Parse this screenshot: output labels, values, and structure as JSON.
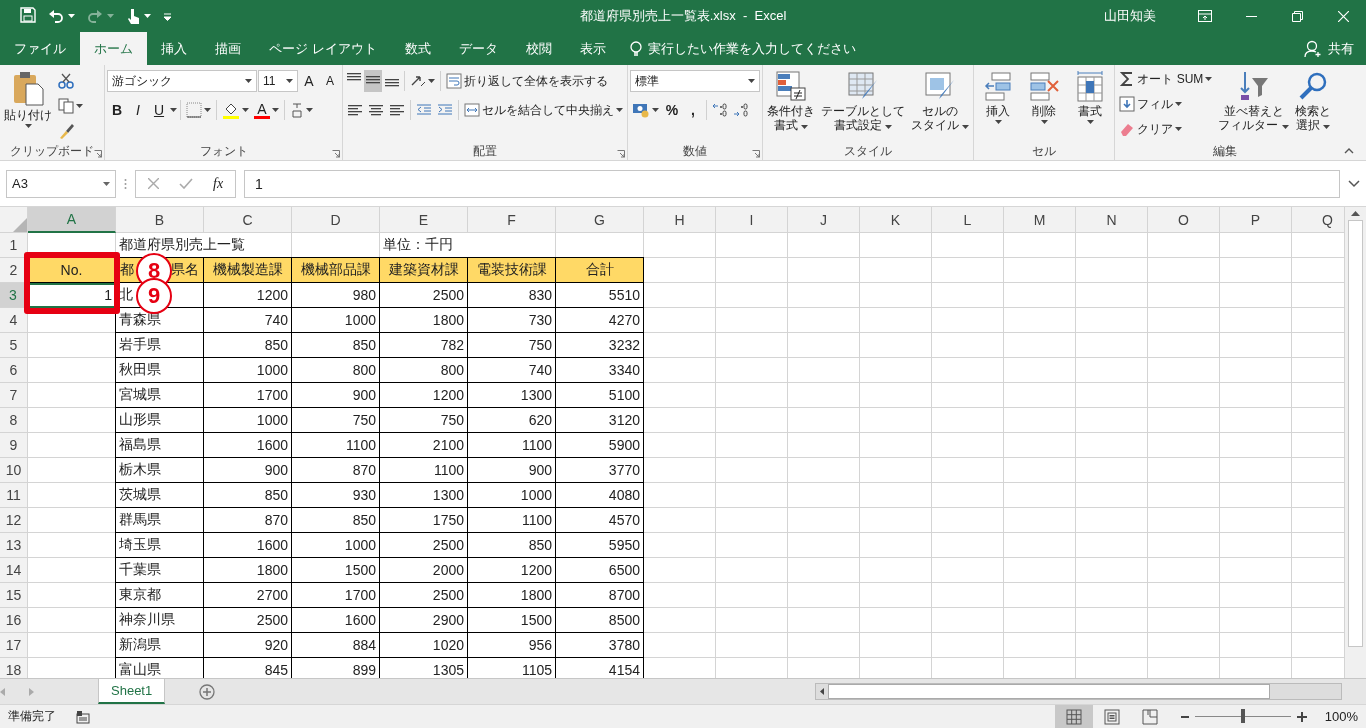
{
  "window": {
    "title": "都道府県別売上一覧表.xlsx  -  Excel",
    "user": "山田知美"
  },
  "tabs": [
    {
      "label": "ファイル",
      "selected": false
    },
    {
      "label": "ホーム",
      "selected": true
    },
    {
      "label": "挿入",
      "selected": false
    },
    {
      "label": "描画",
      "selected": false
    },
    {
      "label": "ページ レイアウト",
      "selected": false
    },
    {
      "label": "数式",
      "selected": false
    },
    {
      "label": "データ",
      "selected": false
    },
    {
      "label": "校閲",
      "selected": false
    },
    {
      "label": "表示",
      "selected": false
    }
  ],
  "tell_me": "実行したい作業を入力してください",
  "share": "共有",
  "ribbon": {
    "clipboard": {
      "label": "クリップボード",
      "paste": "貼り付け"
    },
    "font": {
      "label": "フォント",
      "name": "游ゴシック",
      "size": "11",
      "grow": "A",
      "shrink": "A",
      "styles": [
        "B",
        "I",
        "U"
      ],
      "color_glyph": "A"
    },
    "alignment": {
      "label": "配置",
      "vertical": [
        {
          "selected": false
        },
        {
          "selected": true
        },
        {
          "selected": false
        }
      ],
      "wrap": "折り返して全体を表示する",
      "merge": "セルを結合して中央揃え"
    },
    "number": {
      "label": "数値",
      "format": "標準",
      "symbols": [
        "%",
        ","
      ]
    },
    "styles": {
      "label": "スタイル",
      "buttons": [
        {
          "kind": "conditional",
          "lines": [
            "条件付き",
            "書式"
          ]
        },
        {
          "kind": "table",
          "lines": [
            "テーブルとして",
            "書式設定"
          ]
        },
        {
          "kind": "cell_style",
          "lines": [
            "セルの",
            "スタイル"
          ]
        }
      ]
    },
    "cells": {
      "label": "セル",
      "buttons": [
        {
          "kind": "insert",
          "label": "挿入"
        },
        {
          "kind": "delete",
          "label": "削除"
        },
        {
          "kind": "format",
          "label": "書式"
        }
      ]
    },
    "editing": {
      "label": "編集",
      "small": [
        {
          "kind": "sum",
          "label": "オート SUM"
        },
        {
          "kind": "fill",
          "label": "フィル"
        },
        {
          "kind": "clear",
          "label": "クリア"
        }
      ],
      "big": [
        {
          "kind": "sort",
          "lines": [
            "並べ替えと",
            "フィルター"
          ]
        },
        {
          "kind": "find",
          "lines": [
            "検索と",
            "選択"
          ]
        }
      ]
    }
  },
  "formula_bar": {
    "name_box": "A3",
    "function_label": "fx",
    "value": "1"
  },
  "sheet": {
    "columns": [
      {
        "label": "A",
        "selected": true
      },
      {
        "label": "B",
        "selected": false
      },
      {
        "label": "C",
        "selected": false
      },
      {
        "label": "D",
        "selected": false
      },
      {
        "label": "E",
        "selected": false
      },
      {
        "label": "F",
        "selected": false
      },
      {
        "label": "G",
        "selected": false
      },
      {
        "label": "H",
        "selected": false
      },
      {
        "label": "I",
        "selected": false
      },
      {
        "label": "J",
        "selected": false
      },
      {
        "label": "K",
        "selected": false
      },
      {
        "label": "L",
        "selected": false
      },
      {
        "label": "M",
        "selected": false
      },
      {
        "label": "N",
        "selected": false
      },
      {
        "label": "O",
        "selected": false
      },
      {
        "label": "P",
        "selected": false
      },
      {
        "label": "Q",
        "selected": false
      }
    ],
    "rows": [
      {
        "number": "1",
        "selected": false,
        "kind": "title",
        "b": "都道府県別売上一覧",
        "e": "単位：千円"
      },
      {
        "number": "2",
        "selected": false,
        "kind": "header",
        "a": "No.",
        "b": [
          "都",
          "県名"
        ],
        "c": "機械製造課",
        "d": "機械部品課",
        "e": "建築資材課",
        "f": "電装技術課",
        "g": "合計"
      },
      {
        "number": "3",
        "selected": true,
        "kind": "data",
        "a": "1",
        "b": [
          "北"
        ],
        "c": "1200",
        "d": "980",
        "e": "2500",
        "f": "830",
        "g": "5510"
      },
      {
        "number": "4",
        "selected": false,
        "kind": "data",
        "b": "青森県",
        "c": "740",
        "d": "1000",
        "e": "1800",
        "f": "730",
        "g": "4270"
      },
      {
        "number": "5",
        "selected": false,
        "kind": "data",
        "b": "岩手県",
        "c": "850",
        "d": "850",
        "e": "782",
        "f": "750",
        "g": "3232"
      },
      {
        "number": "6",
        "selected": false,
        "kind": "data",
        "b": "秋田県",
        "c": "1000",
        "d": "800",
        "e": "800",
        "f": "740",
        "g": "3340"
      },
      {
        "number": "7",
        "selected": false,
        "kind": "data",
        "b": "宮城県",
        "c": "1700",
        "d": "900",
        "e": "1200",
        "f": "1300",
        "g": "5100"
      },
      {
        "number": "8",
        "selected": false,
        "kind": "data",
        "b": "山形県",
        "c": "1000",
        "d": "750",
        "e": "750",
        "f": "620",
        "g": "3120"
      },
      {
        "number": "9",
        "selected": false,
        "kind": "data",
        "b": "福島県",
        "c": "1600",
        "d": "1100",
        "e": "2100",
        "f": "1100",
        "g": "5900"
      },
      {
        "number": "10",
        "selected": false,
        "kind": "data",
        "b": "栃木県",
        "c": "900",
        "d": "870",
        "e": "1100",
        "f": "900",
        "g": "3770"
      },
      {
        "number": "11",
        "selected": false,
        "kind": "data",
        "b": "茨城県",
        "c": "850",
        "d": "930",
        "e": "1300",
        "f": "1000",
        "g": "4080"
      },
      {
        "number": "12",
        "selected": false,
        "kind": "data",
        "b": "群馬県",
        "c": "870",
        "d": "850",
        "e": "1750",
        "f": "1100",
        "g": "4570"
      },
      {
        "number": "13",
        "selected": false,
        "kind": "data",
        "b": "埼玉県",
        "c": "1600",
        "d": "1000",
        "e": "2500",
        "f": "850",
        "g": "5950"
      },
      {
        "number": "14",
        "selected": false,
        "kind": "data",
        "b": "千葉県",
        "c": "1800",
        "d": "1500",
        "e": "2000",
        "f": "1200",
        "g": "6500"
      },
      {
        "number": "15",
        "selected": false,
        "kind": "data",
        "b": "東京都",
        "c": "2700",
        "d": "1700",
        "e": "2500",
        "f": "1800",
        "g": "8700"
      },
      {
        "number": "16",
        "selected": false,
        "kind": "data",
        "b": "神奈川県",
        "c": "2500",
        "d": "1600",
        "e": "2900",
        "f": "1500",
        "g": "8500"
      },
      {
        "number": "17",
        "selected": false,
        "kind": "data",
        "b": "新潟県",
        "c": "920",
        "d": "884",
        "e": "1020",
        "f": "956",
        "g": "3780"
      },
      {
        "number": "18",
        "selected": false,
        "kind": "data",
        "b": "富山県",
        "c": "845",
        "d": "899",
        "e": "1305",
        "f": "1105",
        "g": "4154"
      }
    ]
  },
  "annotations": [
    {
      "kind": "box"
    },
    {
      "kind": "circle",
      "label": "8"
    },
    {
      "kind": "circle",
      "label": "9"
    }
  ],
  "sheet_tabs": [
    {
      "label": "Sheet1",
      "selected": true
    }
  ],
  "status": {
    "text": "準備完了",
    "views": [
      {
        "kind": "normal",
        "selected": true
      },
      {
        "kind": "page_layout",
        "selected": false
      },
      {
        "kind": "page_break",
        "selected": false
      }
    ],
    "zoom": {
      "level": 0.5,
      "label": "100%"
    }
  }
}
